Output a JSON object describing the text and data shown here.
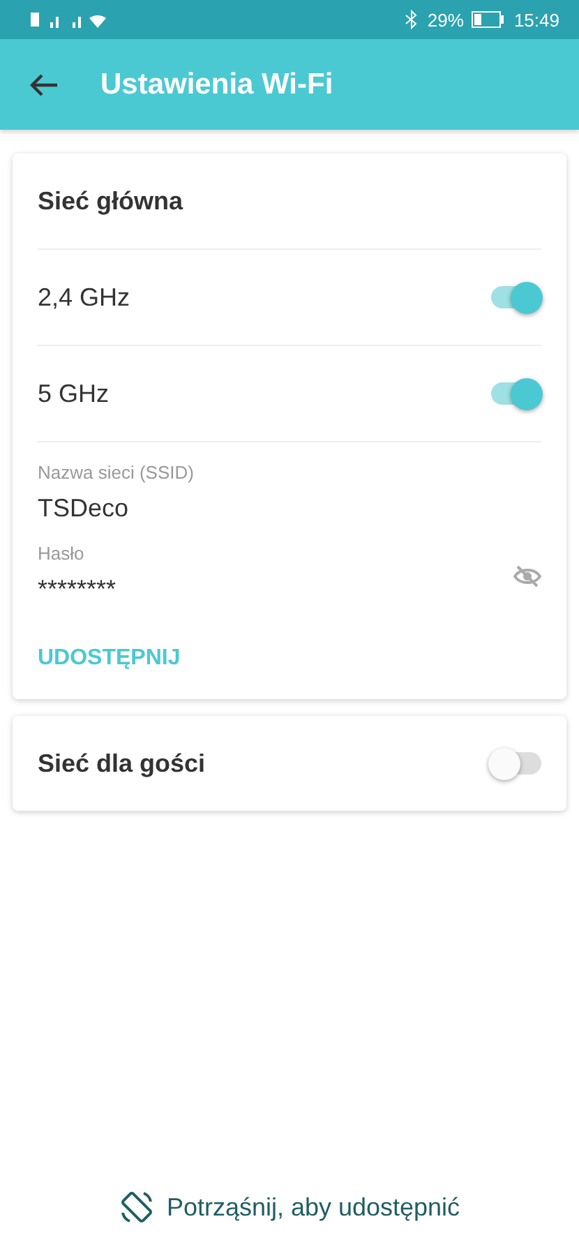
{
  "status_bar": {
    "battery_text": "29%",
    "time": "15:49"
  },
  "header": {
    "title": "Ustawienia Wi-Fi"
  },
  "main_network": {
    "title": "Sieć główna",
    "bands": [
      {
        "label": "2,4 GHz",
        "on": true
      },
      {
        "label": "5 GHz",
        "on": true
      }
    ],
    "ssid": {
      "label": "Nazwa sieci (SSID)",
      "value": "TSDeco"
    },
    "password": {
      "label": "Hasło",
      "value": "********",
      "visible": false
    },
    "share_button": "UDOSTĘPNIJ"
  },
  "guest_network": {
    "label": "Sieć dla gości",
    "on": false
  },
  "shake_hint": "Potrząśnij, aby udostępnić"
}
